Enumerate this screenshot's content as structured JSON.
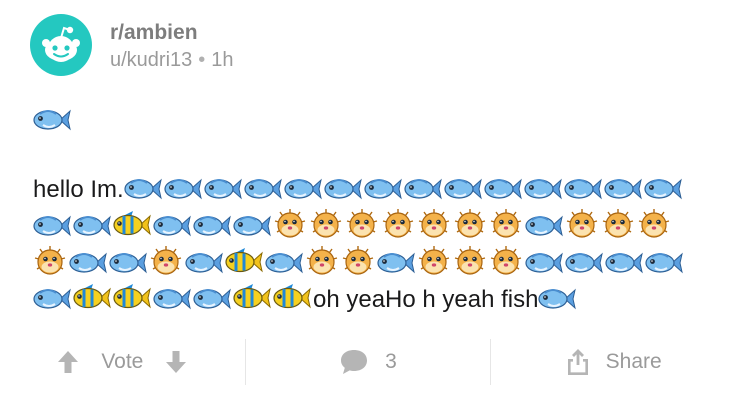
{
  "post": {
    "subreddit": "r/ambien",
    "author": "u/kudri13",
    "separator": "•",
    "age": "1h",
    "lead_emoji": "fish",
    "body_prefix": "hello Im.",
    "body_emojis": [
      "fish",
      "fish",
      "fish",
      "fish",
      "fish",
      "fish",
      "fish",
      "fish",
      "fish",
      "fish",
      "fish",
      "fish",
      "fish",
      "fish",
      "fish",
      "fish",
      "tropical",
      "fish",
      "fish",
      "fish",
      "blowfish",
      "blowfish",
      "blowfish",
      "blowfish",
      "blowfish",
      "blowfish",
      "blowfish",
      "fish",
      "blowfish",
      "blowfish",
      "blowfish",
      "blowfish",
      "fish",
      "fish",
      "blowfish",
      "fish",
      "tropical",
      "fish",
      "blowfish",
      "blowfish",
      "fish",
      "blowfish",
      "blowfish",
      "blowfish",
      "fish",
      "fish",
      "fish",
      "fish",
      "fish",
      "tropical",
      "tropical",
      "fish",
      "fish",
      "tropical",
      "tropical"
    ],
    "body_suffix": "oh yeaHo h yeah fish",
    "trailing_emoji": "fish"
  },
  "footer": {
    "vote_label": "Vote",
    "comment_count": "3",
    "share_label": "Share"
  },
  "colors": {
    "avatar_bg": "#24c8c0",
    "meta_text": "#9a9a9a",
    "icon_gray": "#b5b5b5"
  },
  "icons": [
    "reddit-snoo-icon",
    "fish-emoji",
    "tropical-fish-emoji",
    "blowfish-emoji",
    "upvote-icon",
    "downvote-icon",
    "comment-icon",
    "share-icon"
  ]
}
